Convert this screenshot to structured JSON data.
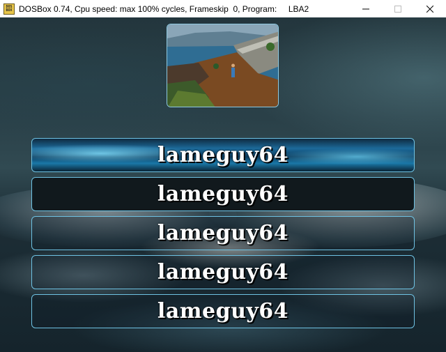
{
  "window": {
    "title": "DOSBox 0.74, Cpu speed: max 100% cycles, Frameskip  0, Program:     LBA2",
    "icon": "dosbox-icon",
    "icon_text": [
      "DOS",
      "BOX"
    ]
  },
  "controls": {
    "minimize": "minimize-icon",
    "maximize": "maximize-icon",
    "close": "close-icon"
  },
  "preview": {
    "description_icon": "savegame-preview-image"
  },
  "save_slots": [
    {
      "label": "lameguy64",
      "selected": true
    },
    {
      "label": "lameguy64",
      "selected": false
    },
    {
      "label": "lameguy64",
      "selected": false
    },
    {
      "label": "lameguy64",
      "selected": false
    },
    {
      "label": "lameguy64",
      "selected": false
    }
  ],
  "colors": {
    "slot_border": "#6fc3e4",
    "selected_slot": "#1c6a9a",
    "text": "#ffffff"
  }
}
